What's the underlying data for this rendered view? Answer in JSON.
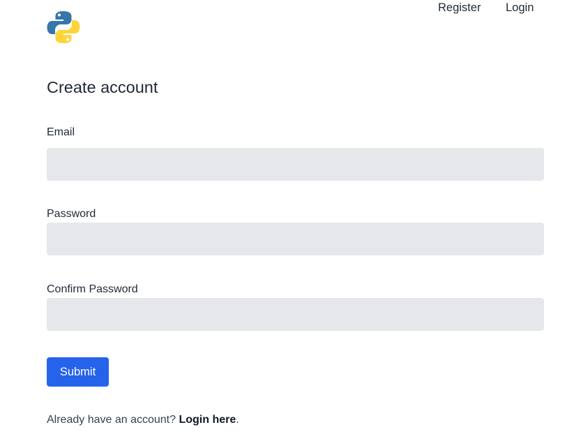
{
  "header": {
    "logo_icon": "python-logo-icon",
    "nav": {
      "register_label": "Register",
      "login_label": "Login"
    }
  },
  "main": {
    "title": "Create account",
    "form": {
      "email": {
        "label": "Email",
        "value": "",
        "placeholder": ""
      },
      "password": {
        "label": "Password",
        "value": "",
        "placeholder": ""
      },
      "confirm_password": {
        "label": "Confirm Password",
        "value": "",
        "placeholder": ""
      },
      "submit_label": "Submit"
    },
    "footer": {
      "prompt": "Already have an account? ",
      "login_link": "Login here",
      "suffix": "."
    }
  },
  "colors": {
    "primary": "#2563eb",
    "input_bg": "#e5e7eb",
    "text": "#1f2937",
    "python_blue": "#3776ab",
    "python_yellow": "#ffd43b"
  }
}
